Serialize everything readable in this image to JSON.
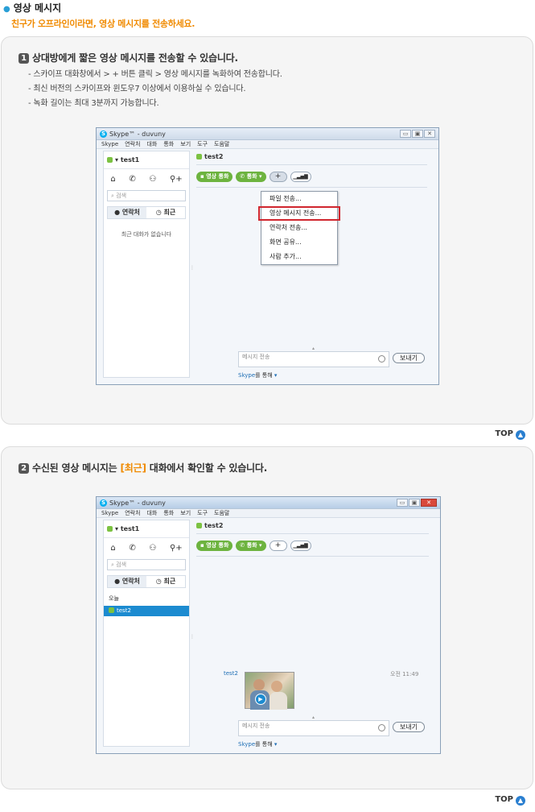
{
  "header": {
    "title": "영상 메시지",
    "subtitle": "친구가 오프라인이라면, 영상 메시지를 전송하세요."
  },
  "step1": {
    "num": "1",
    "title": "상대방에게 짧은 영상 메시지를 전송할 수 있습니다.",
    "bullets": [
      "- 스카이프 대화창에서 > + 버튼 클릭 > 영상 메시지를 녹화하여 전송합니다.",
      "- 최신 버전의 스카이프와 윈도우7 이상에서 이용하실 수 있습니다.",
      "- 녹화 길이는 최대 3분까지 가능합니다."
    ]
  },
  "step2": {
    "num": "2",
    "title_pre": "수신된 영상 메시지는 ",
    "title_hl": "[최근]",
    "title_post": " 대화에서 확인할 수 있습니다."
  },
  "top_link": "TOP",
  "skype": {
    "title": "Skype™ - duvuny",
    "menu": [
      "Skype",
      "연락처",
      "대화",
      "통화",
      "보기",
      "도구",
      "도움말"
    ],
    "user": "test1",
    "search_placeholder": "검색",
    "tab_contacts": "연락처",
    "tab_recent": "최근",
    "empty_recent": "최근 대화가 없습니다",
    "today": "오늘",
    "recent_item": "test2",
    "contact": "test2",
    "video_call": "영상 통화",
    "call": "통화",
    "plus": "+",
    "dropdown": [
      "파일 전송...",
      "영상 메시지 전송...",
      "연락처 전송...",
      "화면 공유...",
      "사람 추가..."
    ],
    "message_placeholder": "메시지 전송",
    "send": "보내기",
    "via_brand": "Skype",
    "via_text": "를 통해",
    "msg_sender": "test2",
    "msg_time": "오전 11:49"
  }
}
